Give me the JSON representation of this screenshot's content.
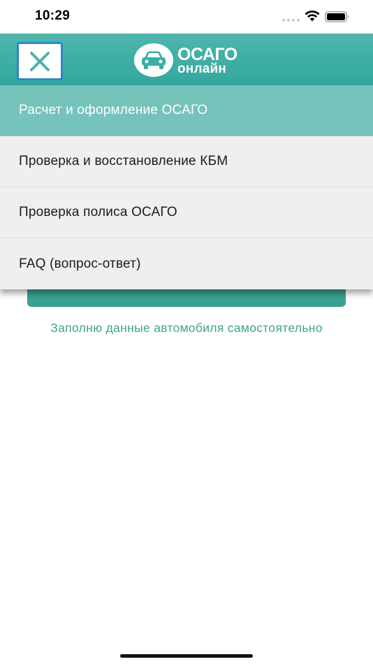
{
  "status_bar": {
    "time": "10:29"
  },
  "header": {
    "logo_line1": "ОСАГО",
    "logo_line2": "онлайн",
    "close_icon": "close-x-icon",
    "logo_icon": "car-icon"
  },
  "menu": {
    "items": [
      {
        "label": "Расчет и оформление ОСАГО",
        "active": true
      },
      {
        "label": "Проверка и восстановление КБМ",
        "active": false
      },
      {
        "label": "Проверка полиса ОСАГО",
        "active": false
      },
      {
        "label": "FAQ (вопрос-ответ)",
        "active": false
      }
    ]
  },
  "background": {
    "link_text": "Заполню данные автомобиля самостоятельно"
  },
  "colors": {
    "header": "#3aaea4",
    "active_item": "#75c3bb",
    "close_border": "#2f86c5",
    "link": "#3fa48d"
  }
}
